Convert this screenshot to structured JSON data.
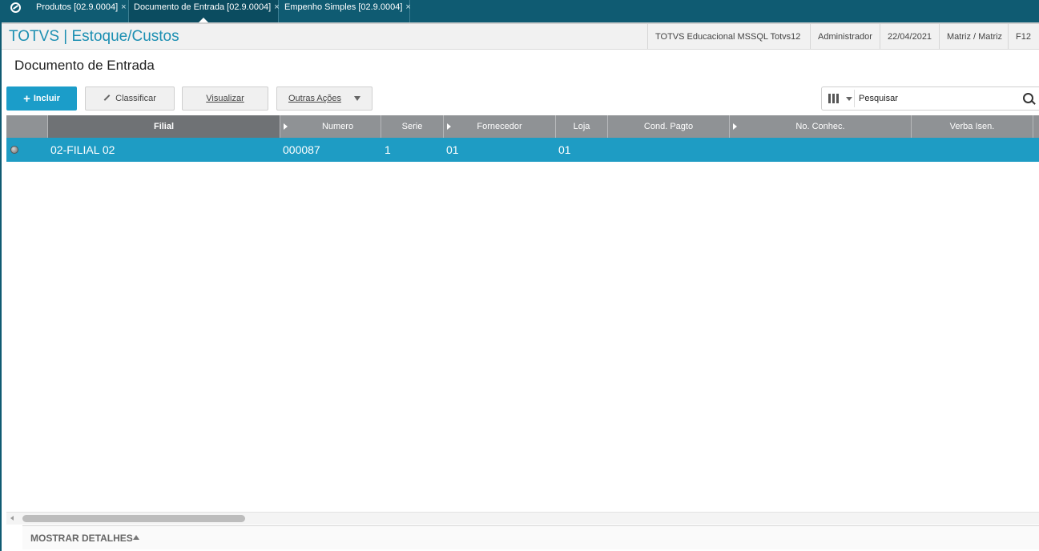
{
  "tabs": [
    {
      "label": "Produtos [02.9.0004]",
      "close": "×"
    },
    {
      "label": "Documento de Entrada [02.9.0004]",
      "close": "×"
    },
    {
      "label": "Empenho Simples [02.9.0004]",
      "close": "×"
    }
  ],
  "header": {
    "app_title": "TOTVS | Estoque/Custos",
    "environment": "TOTVS Educacional MSSQL Totvs12",
    "user": "Administrador",
    "date": "22/04/2021",
    "branch": "Matriz / Matriz",
    "shortcut": "F12"
  },
  "page": {
    "title": "Documento de Entrada"
  },
  "toolbar": {
    "include_label": "Incluir",
    "classify_label": "Classificar",
    "view_label": "Visualizar",
    "other_actions_label": "Outras Ações"
  },
  "search": {
    "placeholder": "Pesquisar"
  },
  "grid": {
    "columns": [
      "Filial",
      "Numero",
      "Serie",
      "Fornecedor",
      "Loja",
      "Cond. Pagto",
      "No. Conhec.",
      "Verba Isen."
    ],
    "rows": [
      {
        "filial": "02-FILIAL 02",
        "numero": "000087",
        "serie": "1",
        "fornecedor": "01",
        "loja": "01",
        "cond_pagto": "",
        "no_conhec": "",
        "verba_isen": ""
      }
    ]
  },
  "footer": {
    "details_label": "MOSTRAR DETALHES"
  },
  "colors": {
    "brand": "#0f5b72",
    "accent": "#1b9dc9",
    "selected_row": "#1e9cc4"
  }
}
